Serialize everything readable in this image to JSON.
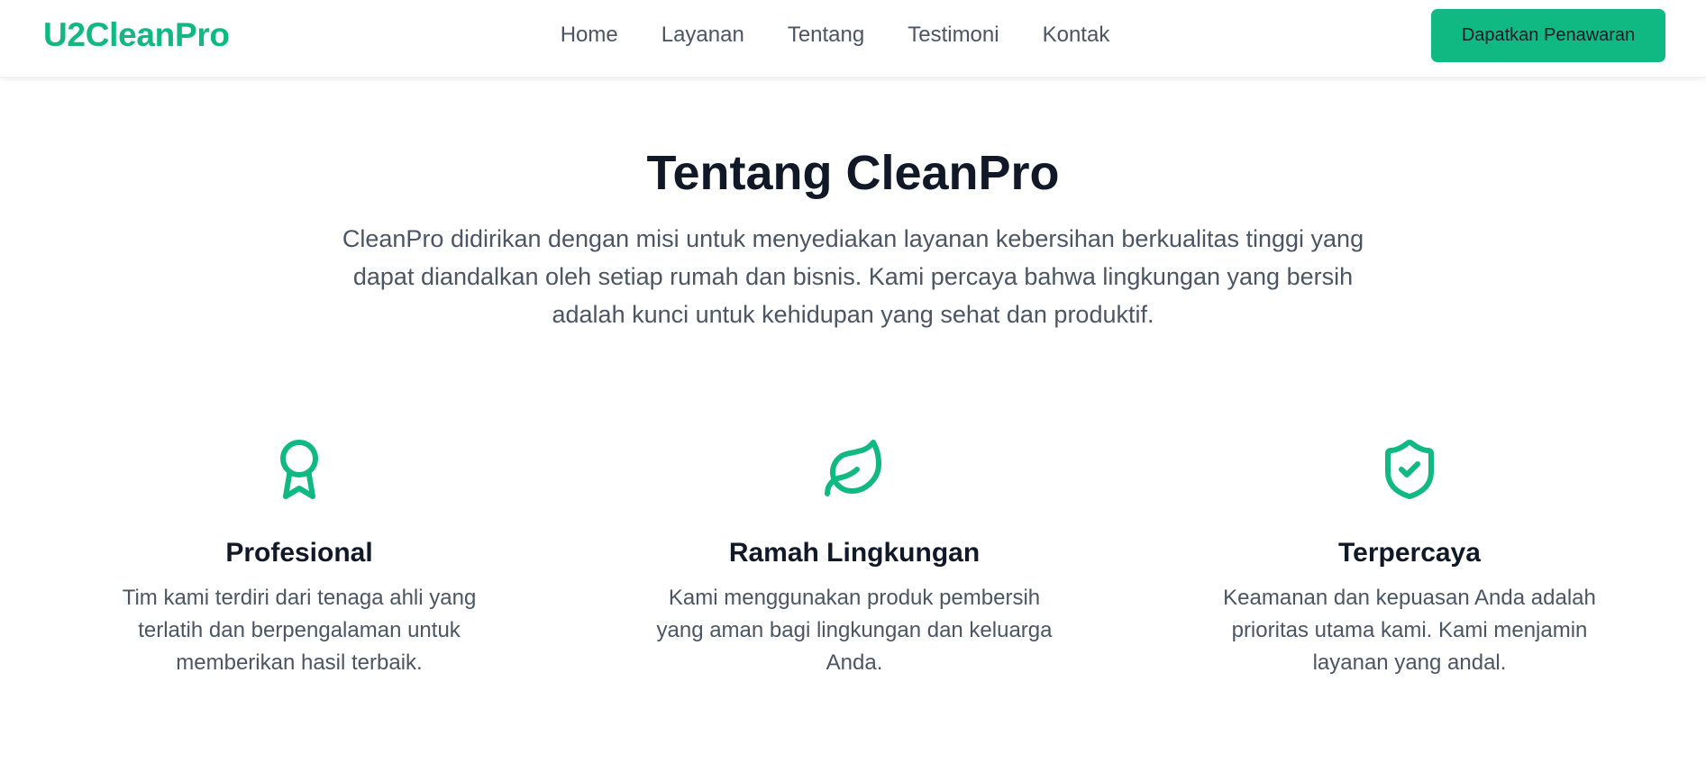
{
  "brand": {
    "name": "U2CleanPro",
    "accent_color": "#10b981"
  },
  "nav": {
    "links": [
      "Home",
      "Layanan",
      "Tentang",
      "Testimoni",
      "Kontak"
    ],
    "cta_label": "Dapatkan Penawaran"
  },
  "about": {
    "title": "Tentang CleanPro",
    "description": "CleanPro didirikan dengan misi untuk menyediakan layanan kebersihan berkualitas tinggi yang dapat diandalkan oleh setiap rumah dan bisnis. Kami percaya bahwa lingkungan yang bersih adalah kunci untuk kehidupan yang sehat dan produktif."
  },
  "features": [
    {
      "icon": "award-icon",
      "title": "Profesional",
      "description": "Tim kami terdiri dari tenaga ahli yang terlatih dan berpengalaman untuk memberikan hasil terbaik."
    },
    {
      "icon": "leaf-icon",
      "title": "Ramah Lingkungan",
      "description": "Kami menggunakan produk pembersih yang aman bagi lingkungan dan keluarga Anda."
    },
    {
      "icon": "shield-check-icon",
      "title": "Terpercaya",
      "description": "Keamanan dan kepuasan Anda adalah prioritas utama kami. Kami menjamin layanan yang andal."
    }
  ]
}
